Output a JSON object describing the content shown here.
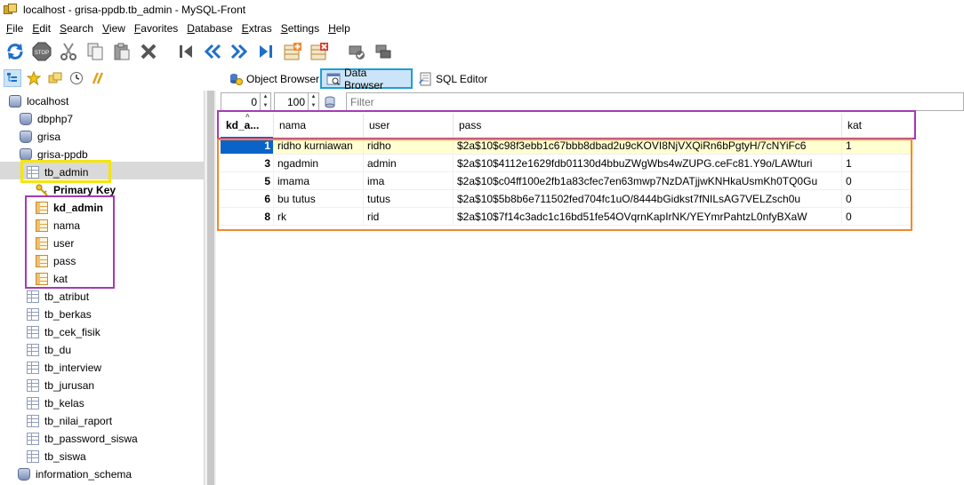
{
  "window": {
    "title": "localhost - grisa-ppdb.tb_admin - MySQL-Front"
  },
  "menu": [
    {
      "label": "File",
      "u": "F",
      "rest": "ile"
    },
    {
      "label": "Edit",
      "u": "E",
      "rest": "dit"
    },
    {
      "label": "Search",
      "u": "S",
      "rest": "earch"
    },
    {
      "label": "View",
      "u": "V",
      "rest": "iew"
    },
    {
      "label": "Favorites",
      "u": "F",
      "rest": "avorites"
    },
    {
      "label": "Database",
      "u": "D",
      "rest": "atabase"
    },
    {
      "label": "Extras",
      "u": "E",
      "rest": "xtras"
    },
    {
      "label": "Settings",
      "u": "S",
      "rest": "ettings"
    },
    {
      "label": "Help",
      "u": "H",
      "rest": "elp"
    }
  ],
  "viewbar": {
    "tabs": {
      "object_browser": "Object Browser",
      "data_browser": "Data Browser",
      "sql_editor": "SQL Editor"
    }
  },
  "tree": {
    "host": "localhost",
    "databases": [
      "dbphp7",
      "grisa",
      "grisa-ppdb"
    ],
    "selected_table": "tb_admin",
    "primary_key_label": "Primary Key",
    "fields": [
      "kd_admin",
      "nama",
      "user",
      "pass",
      "kat"
    ],
    "other_tables": [
      "tb_atribut",
      "tb_berkas",
      "tb_cek_fisik",
      "tb_du",
      "tb_interview",
      "tb_jurusan",
      "tb_kelas",
      "tb_nilai_raport",
      "tb_password_siswa",
      "tb_siswa"
    ],
    "schema": "information_schema"
  },
  "filter": {
    "offset": "0",
    "limit": "100",
    "placeholder": "Filter"
  },
  "grid": {
    "columns": [
      "kd_a...",
      "nama",
      "user",
      "pass",
      "kat"
    ],
    "rows": [
      [
        "1",
        "ridho kurniawan",
        "ridho",
        "$2a$10$c98f3ebb1c67bbb8dbad2u9cKOVI8NjVXQiRn6bPgtyH/7cNYiFc6",
        "1"
      ],
      [
        "3",
        "ngadmin",
        "admin",
        "$2a$10$4112e1629fdb01130d4bbuZWgWbs4wZUPG.ceFc81.Y9o/LAWturi",
        "1"
      ],
      [
        "5",
        "imama",
        "ima",
        "$2a$10$c04ff100e2fb1a83cfec7en63mwp7NzDATjjwKNHkaUsmKh0TQ0Gu",
        "0"
      ],
      [
        "6",
        "bu tutus",
        "tutus",
        "$2a$10$5b8b6e711502fed704fc1uO/8444bGidkst7fNILsAG7VELZsch0u",
        "0"
      ],
      [
        "8",
        "rk",
        "rid",
        "$2a$10$7f14c3adc1c16bd51fe54OVqrnKapIrNK/YEYmrPahtzL0nfyBXaW",
        "0"
      ]
    ]
  },
  "colors": {
    "highlight_yellow": "#f5e50a",
    "highlight_purple": "#a53ab6",
    "highlight_orange": "#f08a2c",
    "highlight_blue": "#1e9fd4",
    "selection_blue": "#0a64c8"
  }
}
